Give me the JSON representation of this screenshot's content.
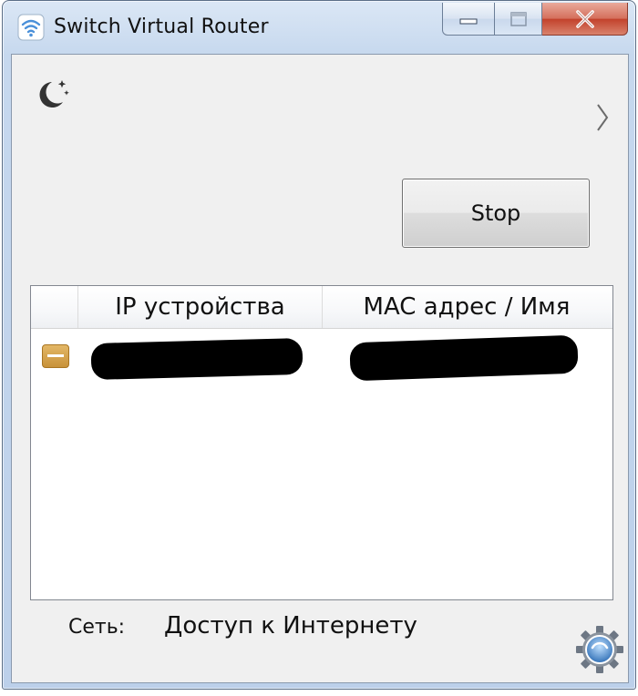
{
  "window": {
    "title": "Switch Virtual Router",
    "controls": {
      "minimize": "minimize-icon",
      "maximize": "maximize-icon",
      "close": "close-icon"
    }
  },
  "toolbar": {
    "theme_icon": "moon-stars-icon",
    "expand_icon": "chevron-right-icon",
    "stop_label": "Stop"
  },
  "devices": {
    "columns": [
      "",
      "IP устройства",
      "MAC адрес / Имя"
    ],
    "rows": [
      {
        "icon": "device-icon",
        "ip": "",
        "mac": ""
      }
    ]
  },
  "status": {
    "label": "Сеть:",
    "value": "Доступ к Интернету",
    "settings_icon": "gear-icon"
  },
  "colors": {
    "accent": "#4a90d9",
    "close_button": "#c2412b",
    "device_icon": "#d4a24c"
  }
}
